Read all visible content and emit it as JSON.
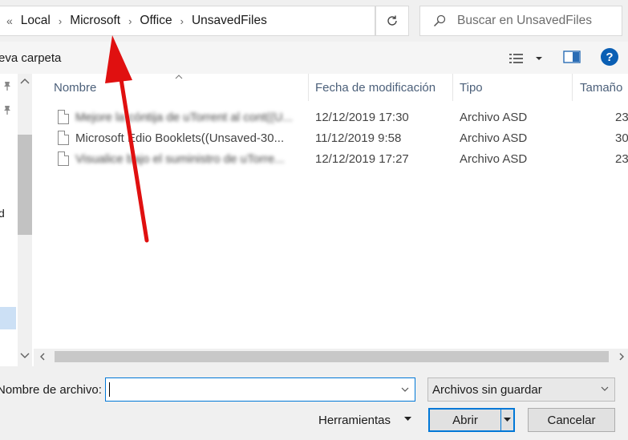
{
  "address_bar": {
    "overflow": "«",
    "crumbs": [
      "Local",
      "Microsoft",
      "Office",
      "UnsavedFiles"
    ],
    "separator": "›"
  },
  "search": {
    "placeholder": "Buscar en UnsavedFiles"
  },
  "toolbar": {
    "new_folder": "eva carpeta",
    "help": "?"
  },
  "nav_pane": {
    "partial_labels": [
      "d"
    ]
  },
  "columns": {
    "name": "Nombre",
    "date": "Fecha de modificación",
    "type": "Tipo",
    "size": "Tamaño"
  },
  "files": [
    {
      "name": "Mejore la cóntija de uTorrent al cont((U...",
      "date": "12/12/2019 17:30",
      "type": "Archivo ASD",
      "size": "23"
    },
    {
      "name": "Microsoft Edio Booklets((Unsaved-30...",
      "date": "11/12/2019 9:58",
      "type": "Archivo ASD",
      "size": "30"
    },
    {
      "name": "Visualice bajo el suministro de uTorre...",
      "date": "12/12/2019 17:27",
      "type": "Archivo ASD",
      "size": "23"
    }
  ],
  "bottom": {
    "filename_label": "Nombre de archivo:",
    "filename_value": "",
    "filetype": "Archivos sin guardar",
    "tools": "Herramientas",
    "open": "Abrir",
    "cancel": "Cancelar"
  },
  "colors": {
    "accent": "#0078d7",
    "annotation": "#e01010"
  }
}
